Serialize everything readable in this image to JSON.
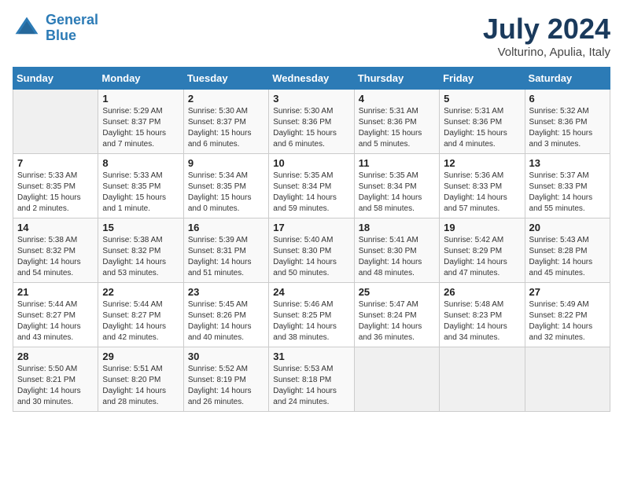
{
  "header": {
    "logo_line1": "General",
    "logo_line2": "Blue",
    "month": "July 2024",
    "location": "Volturino, Apulia, Italy"
  },
  "weekdays": [
    "Sunday",
    "Monday",
    "Tuesday",
    "Wednesday",
    "Thursday",
    "Friday",
    "Saturday"
  ],
  "weeks": [
    [
      {
        "day": "",
        "info": ""
      },
      {
        "day": "1",
        "info": "Sunrise: 5:29 AM\nSunset: 8:37 PM\nDaylight: 15 hours\nand 7 minutes."
      },
      {
        "day": "2",
        "info": "Sunrise: 5:30 AM\nSunset: 8:37 PM\nDaylight: 15 hours\nand 6 minutes."
      },
      {
        "day": "3",
        "info": "Sunrise: 5:30 AM\nSunset: 8:36 PM\nDaylight: 15 hours\nand 6 minutes."
      },
      {
        "day": "4",
        "info": "Sunrise: 5:31 AM\nSunset: 8:36 PM\nDaylight: 15 hours\nand 5 minutes."
      },
      {
        "day": "5",
        "info": "Sunrise: 5:31 AM\nSunset: 8:36 PM\nDaylight: 15 hours\nand 4 minutes."
      },
      {
        "day": "6",
        "info": "Sunrise: 5:32 AM\nSunset: 8:36 PM\nDaylight: 15 hours\nand 3 minutes."
      }
    ],
    [
      {
        "day": "7",
        "info": "Sunrise: 5:33 AM\nSunset: 8:35 PM\nDaylight: 15 hours\nand 2 minutes."
      },
      {
        "day": "8",
        "info": "Sunrise: 5:33 AM\nSunset: 8:35 PM\nDaylight: 15 hours\nand 1 minute."
      },
      {
        "day": "9",
        "info": "Sunrise: 5:34 AM\nSunset: 8:35 PM\nDaylight: 15 hours\nand 0 minutes."
      },
      {
        "day": "10",
        "info": "Sunrise: 5:35 AM\nSunset: 8:34 PM\nDaylight: 14 hours\nand 59 minutes."
      },
      {
        "day": "11",
        "info": "Sunrise: 5:35 AM\nSunset: 8:34 PM\nDaylight: 14 hours\nand 58 minutes."
      },
      {
        "day": "12",
        "info": "Sunrise: 5:36 AM\nSunset: 8:33 PM\nDaylight: 14 hours\nand 57 minutes."
      },
      {
        "day": "13",
        "info": "Sunrise: 5:37 AM\nSunset: 8:33 PM\nDaylight: 14 hours\nand 55 minutes."
      }
    ],
    [
      {
        "day": "14",
        "info": "Sunrise: 5:38 AM\nSunset: 8:32 PM\nDaylight: 14 hours\nand 54 minutes."
      },
      {
        "day": "15",
        "info": "Sunrise: 5:38 AM\nSunset: 8:32 PM\nDaylight: 14 hours\nand 53 minutes."
      },
      {
        "day": "16",
        "info": "Sunrise: 5:39 AM\nSunset: 8:31 PM\nDaylight: 14 hours\nand 51 minutes."
      },
      {
        "day": "17",
        "info": "Sunrise: 5:40 AM\nSunset: 8:30 PM\nDaylight: 14 hours\nand 50 minutes."
      },
      {
        "day": "18",
        "info": "Sunrise: 5:41 AM\nSunset: 8:30 PM\nDaylight: 14 hours\nand 48 minutes."
      },
      {
        "day": "19",
        "info": "Sunrise: 5:42 AM\nSunset: 8:29 PM\nDaylight: 14 hours\nand 47 minutes."
      },
      {
        "day": "20",
        "info": "Sunrise: 5:43 AM\nSunset: 8:28 PM\nDaylight: 14 hours\nand 45 minutes."
      }
    ],
    [
      {
        "day": "21",
        "info": "Sunrise: 5:44 AM\nSunset: 8:27 PM\nDaylight: 14 hours\nand 43 minutes."
      },
      {
        "day": "22",
        "info": "Sunrise: 5:44 AM\nSunset: 8:27 PM\nDaylight: 14 hours\nand 42 minutes."
      },
      {
        "day": "23",
        "info": "Sunrise: 5:45 AM\nSunset: 8:26 PM\nDaylight: 14 hours\nand 40 minutes."
      },
      {
        "day": "24",
        "info": "Sunrise: 5:46 AM\nSunset: 8:25 PM\nDaylight: 14 hours\nand 38 minutes."
      },
      {
        "day": "25",
        "info": "Sunrise: 5:47 AM\nSunset: 8:24 PM\nDaylight: 14 hours\nand 36 minutes."
      },
      {
        "day": "26",
        "info": "Sunrise: 5:48 AM\nSunset: 8:23 PM\nDaylight: 14 hours\nand 34 minutes."
      },
      {
        "day": "27",
        "info": "Sunrise: 5:49 AM\nSunset: 8:22 PM\nDaylight: 14 hours\nand 32 minutes."
      }
    ],
    [
      {
        "day": "28",
        "info": "Sunrise: 5:50 AM\nSunset: 8:21 PM\nDaylight: 14 hours\nand 30 minutes."
      },
      {
        "day": "29",
        "info": "Sunrise: 5:51 AM\nSunset: 8:20 PM\nDaylight: 14 hours\nand 28 minutes."
      },
      {
        "day": "30",
        "info": "Sunrise: 5:52 AM\nSunset: 8:19 PM\nDaylight: 14 hours\nand 26 minutes."
      },
      {
        "day": "31",
        "info": "Sunrise: 5:53 AM\nSunset: 8:18 PM\nDaylight: 14 hours\nand 24 minutes."
      },
      {
        "day": "",
        "info": ""
      },
      {
        "day": "",
        "info": ""
      },
      {
        "day": "",
        "info": ""
      }
    ]
  ]
}
